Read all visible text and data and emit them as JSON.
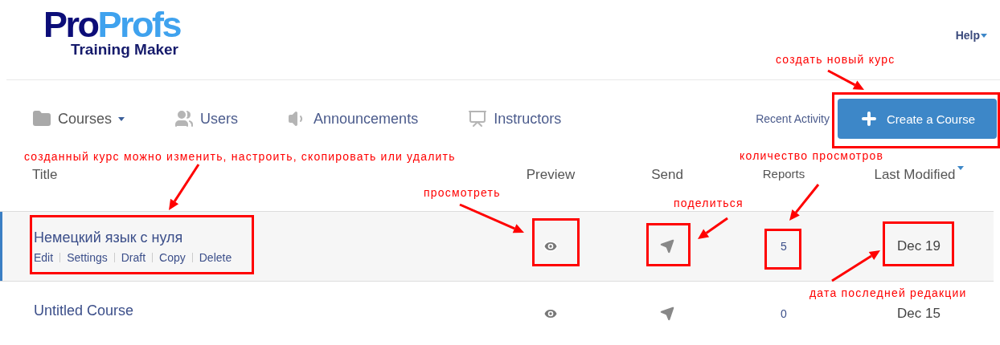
{
  "logo": {
    "brand_part_1": "Pro",
    "brand_part_2": "Profs",
    "product": "Training Maker"
  },
  "help_menu": {
    "label": "Help"
  },
  "nav": [
    {
      "label": "Courses",
      "kind": "folder",
      "has_dropdown": true
    },
    {
      "label": "Users",
      "kind": "users",
      "has_dropdown": false
    },
    {
      "label": "Announcements",
      "kind": "announcement",
      "has_dropdown": false
    },
    {
      "label": "Instructors",
      "kind": "instructor",
      "has_dropdown": false
    }
  ],
  "recent_activity": "Recent Activity",
  "create_button": {
    "label": "Create a Course"
  },
  "table": {
    "columns": [
      {
        "label": "Title",
        "sorted": false
      },
      {
        "label": "Preview",
        "sorted": false
      },
      {
        "label": "Send",
        "sorted": false
      },
      {
        "label": "Reports",
        "sorted": false
      },
      {
        "label": "Last Modified",
        "sorted": true
      }
    ],
    "rows": [
      {
        "title": "Немецкий язык с нуля",
        "selected": true,
        "actions": [
          "Edit",
          "Settings",
          "Draft",
          "Copy",
          "Delete"
        ],
        "reports": "5",
        "last_modified": "Dec 19"
      },
      {
        "title": "Untitled Course",
        "selected": false,
        "actions": [],
        "reports": "0",
        "last_modified": "Dec 15"
      }
    ]
  },
  "annotations": [
    {
      "text": "создать новый курс"
    },
    {
      "text": "созданный курс можно изменить, настроить, скопировать или удалить"
    },
    {
      "text": "просмотреть"
    },
    {
      "text": "поделиться"
    },
    {
      "text": "количество просмотров"
    },
    {
      "text": "дата последней редакции"
    }
  ]
}
